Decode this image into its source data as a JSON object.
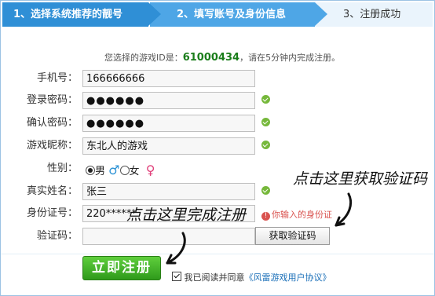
{
  "steps": [
    {
      "label": "1、选择系统推荐的靓号",
      "active": true
    },
    {
      "label": "2、填写账号及身份信息",
      "active": true
    },
    {
      "label": "3、注册成功",
      "active": false
    }
  ],
  "hint": {
    "prefix": "您选择的游戏ID是：",
    "id": "61000434",
    "suffix": "，请在5分钟内完成注册。"
  },
  "form": {
    "phone": {
      "label": "手机号：",
      "value": "166666666"
    },
    "password": {
      "label": "登录密码：",
      "value": "●●●●●●"
    },
    "confirm": {
      "label": "确认密码：",
      "value": "●●●●●●"
    },
    "nickname": {
      "label": "游戏昵称：",
      "value": "东北人的游戏"
    },
    "gender": {
      "label": "性别：",
      "male": "男",
      "female": "女",
      "male_symbol": "♂",
      "female_symbol": "♀",
      "selected": "male"
    },
    "realname": {
      "label": "真实姓名：",
      "value": "张三"
    },
    "idcard": {
      "label": "身份证号：",
      "value": "220******",
      "error": "你输入的身份证"
    },
    "captcha": {
      "label": "验证码：",
      "value": "",
      "button": "获取验证码"
    }
  },
  "submit": {
    "label": "立即注册"
  },
  "agree": {
    "text": "我已阅读并同意",
    "link": "《风雷游戏用户协议》"
  },
  "annotations": {
    "get_code": "点击这里获取验证码",
    "complete": "点击这里完成注册"
  },
  "colors": {
    "step_active": "#2f8fd6",
    "id_green": "#1a7d1a",
    "ok_green": "#76b83b",
    "error_red": "#d9534f",
    "submit_green": "#3aa823"
  }
}
